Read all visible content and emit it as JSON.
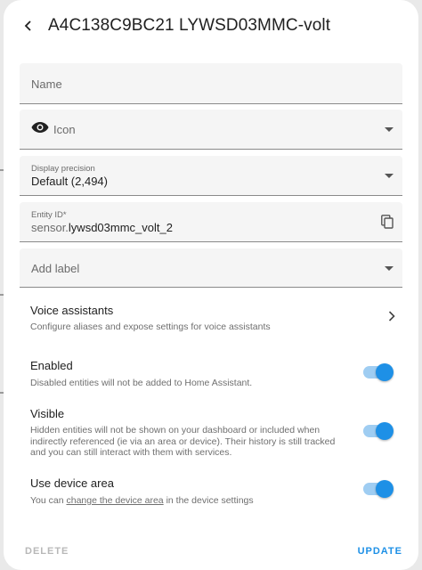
{
  "header": {
    "title": "A4C138C9BC21 LYWSD03MMC-volt"
  },
  "form": {
    "name_label": "Name",
    "icon_label": "Icon",
    "precision_label": "Display precision",
    "precision_value": "Default (2,494)",
    "entity_id_label": "Entity ID*",
    "entity_id_prefix": "sensor.",
    "entity_id_value": "lywsd03mmc_volt_2",
    "add_label": "Add label"
  },
  "voice": {
    "title": "Voice assistants",
    "subtitle": "Configure aliases and expose settings for voice assistants"
  },
  "enabled": {
    "title": "Enabled",
    "subtitle": "Disabled entities will not be added to Home Assistant.",
    "checked": true
  },
  "visible": {
    "title": "Visible",
    "subtitle": "Hidden entities will not be shown on your dashboard or included when indirectly referenced (ie via an area or device). Their history is still tracked and you can still interact with them with services.",
    "checked": true
  },
  "device_area": {
    "title": "Use device area",
    "subtitle_before": "You can ",
    "subtitle_link": "change the device area",
    "subtitle_after": " in the device settings",
    "checked": true
  },
  "footer": {
    "delete_label": "DELETE",
    "update_label": "UPDATE"
  },
  "colors": {
    "accent": "#1e90e6",
    "track": "#9fcdf2",
    "field_bg": "#f5f5f5",
    "disabled": "#b8b8b8"
  }
}
